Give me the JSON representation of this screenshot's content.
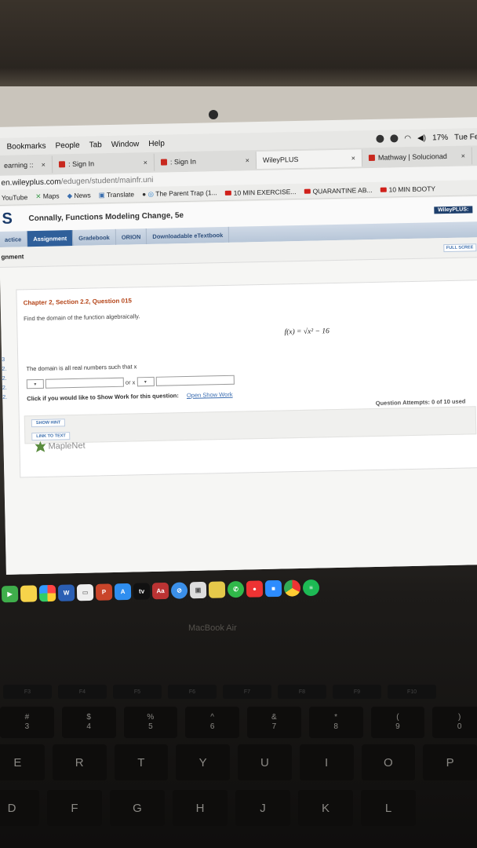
{
  "menu_bar": {
    "items": [
      "Bookmarks",
      "People",
      "Tab",
      "Window",
      "Help"
    ],
    "battery": "17%",
    "clock": "Tue Fe"
  },
  "tabs": [
    {
      "label": "earning ::",
      "active": false
    },
    {
      "label": ": Sign In",
      "active": false
    },
    {
      "label": ": Sign In",
      "active": false
    },
    {
      "label": "WileyPLUS",
      "active": true
    },
    {
      "label": "Mathway | Solucionad",
      "active": false
    }
  ],
  "url": {
    "host": "en.wileyplus.com",
    "path": "/edugen/student/mainfr.uni"
  },
  "bookmarks": [
    "YouTube",
    "Maps",
    "News",
    "Translate",
    "The Parent Trap (1...",
    "10 MIN EXERCISE...",
    "QUARANTINE AB...",
    "10 MIN BOOTY",
    "WileyPLUS:"
  ],
  "site": {
    "logo": "S",
    "course_title": "Connally, Functions Modeling Change, 5e",
    "nav": [
      "actice",
      "Assignment",
      "Gradebook",
      "ORION",
      "Downloadable eTextbook"
    ],
    "section": "gnment",
    "full_screen": "FULL SCREE"
  },
  "question": {
    "title": "Chapter 2, Section 2.2, Question 015",
    "prompt": "Find the domain of the function algebraically.",
    "formula": "f(x) = √x² − 16",
    "domain_text": "The domain is all real numbers such that x",
    "or_text": "or x",
    "show_work_text": "Click if you would like to Show Work for this question:",
    "show_work_link": "Open Show Work",
    "hint_button": "SHOW HINT",
    "link_button": "LINK TO TEXT",
    "attempts": "Question Attempts: 0 of 10 used",
    "powered_by": "MapleNet"
  },
  "dock_icons": [
    "facetime-icon",
    "notes-icon",
    "photos-icon",
    "word-icon",
    "keynote-icon",
    "powerpoint-icon",
    "app-store-icon",
    "apple-tv-icon",
    "dictionary-icon",
    "safari-icon",
    "preview-icon",
    "photo-booth-icon",
    "whatsapp-icon",
    "app-icon",
    "zoom-icon",
    "chrome-icon",
    "spotify-icon"
  ],
  "laptop_brand": "MacBook Air",
  "keyboard": {
    "number_row": [
      [
        "#",
        "3"
      ],
      [
        "$",
        "4"
      ],
      [
        "%",
        "5"
      ],
      [
        "^",
        "6"
      ],
      [
        "&",
        "7"
      ],
      [
        "*",
        "8"
      ],
      [
        "(",
        "9"
      ],
      [
        ")",
        "0"
      ]
    ],
    "row_q": [
      "E",
      "R",
      "T",
      "Y",
      "U",
      "I",
      "O",
      "P"
    ],
    "row_a": [
      "D",
      "F",
      "G",
      "H",
      "J",
      "K",
      "L"
    ]
  }
}
